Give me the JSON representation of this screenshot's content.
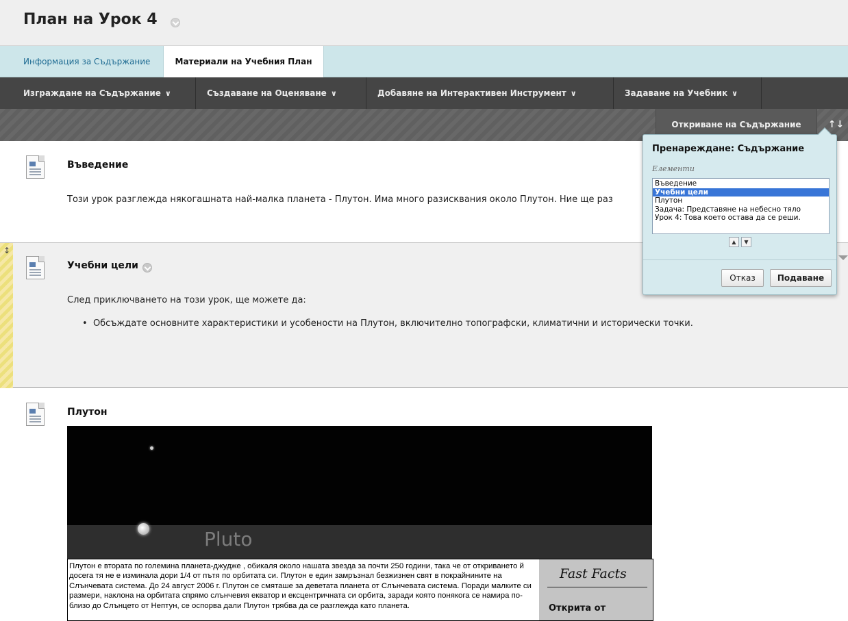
{
  "page": {
    "title": "План на Урок 4"
  },
  "tabs": [
    {
      "label": "Информация за Съдържание"
    },
    {
      "label": "Материали на Учебния План"
    }
  ],
  "action_menu": [
    {
      "label": "Изграждане на Съдържание"
    },
    {
      "label": "Създаване на Оценяване"
    },
    {
      "label": "Добавяне на Интерактивен Инструмент"
    },
    {
      "label": "Задаване на Учебник"
    }
  ],
  "toolbar": {
    "open_content": "Откриване на Съдържание",
    "sort_icon": "↑↓"
  },
  "items": [
    {
      "title": "Въведение",
      "text": "Този урок разглежда някогашната най-малка планета - Плутон. Има много разисквания около Плутон. Ние ще раз"
    },
    {
      "title": "Учебни цели",
      "intro": "След приключването на този урок, ще можете да:",
      "bullet": "Обсъждате основните характеристики и усобености на Плутон, включително топографски, климатични и исторически точки."
    },
    {
      "title": "Плутон",
      "image_caption": "Pluto",
      "body": "Плутон е втората по големина планета-джудже , обикаля около нашата звезда за почти 250 години, така че от откриването й досега тя не е изминала дори 1/4 от пътя по орбитата си. Плутон е един замръзнал безжизнен свят в покрайнините на Слънчевата система. До 24 август 2006 г. Плутон се смяташе за деветата планета от Слънчевата система. Поради малките си размери, наклона на орбитата спрямо слънчевия екватор и ексцентричната си орбита, заради която понякога се намира по-близо до Слънцето от Нептун, се оспорва дали Плутон трябва да се разглежда като планета.",
      "fast_facts_title": "Fast Facts",
      "fast_facts_label": "Открита от"
    }
  ],
  "reorder_popup": {
    "title": "Пренареждане: Съдържание",
    "label": "Елементи",
    "options": [
      "Въведение",
      "Учебни цели",
      "Плутон",
      "Задача: Представяне на небесно тяло",
      "Урок 4: Това което остава да се реши."
    ],
    "selected_index": 1,
    "cancel": "Отказ",
    "submit": "Подаване"
  },
  "colors": {
    "tab_bar": "#cde6ea",
    "action_bar": "#454545",
    "selected_option": "#3875d7",
    "link": "#1f6c93"
  }
}
